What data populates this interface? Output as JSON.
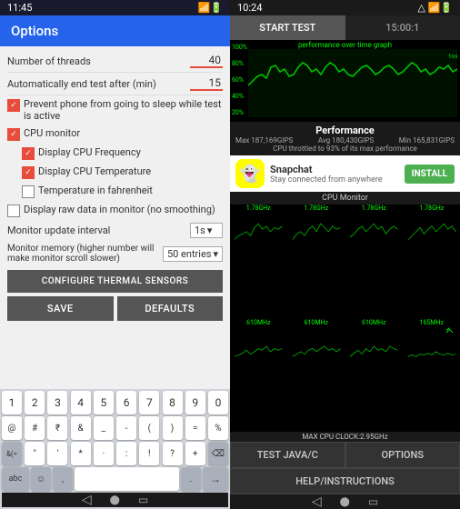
{
  "left": {
    "status_bar": {
      "time": "11:45",
      "icons": "status-icons"
    },
    "title": "Options",
    "fields": {
      "threads_label": "Number of threads",
      "threads_value": "40",
      "auto_end_label": "Automatically end test after (min)",
      "auto_end_value": "15"
    },
    "checkboxes": [
      {
        "id": "prevent_sleep",
        "label": "Prevent phone from going to sleep while test is active",
        "checked": true
      },
      {
        "id": "cpu_monitor",
        "label": "CPU monitor",
        "checked": true
      },
      {
        "id": "cpu_freq",
        "label": "Display CPU Frequency",
        "checked": true,
        "indent": true
      },
      {
        "id": "cpu_temp",
        "label": "Display CPU Temperature",
        "checked": true,
        "indent": true
      },
      {
        "id": "fahrenheit",
        "label": "Temperature in fahrenheit",
        "checked": false,
        "indent": true
      },
      {
        "id": "raw_data",
        "label": "Display raw data in monitor (no smoothing)",
        "checked": false,
        "indent": false
      }
    ],
    "interval_label": "Monitor update interval",
    "interval_value": "1s",
    "memory_label": "Monitor memory (higher number will make monitor scroll slower)",
    "memory_value": "50 entries",
    "configure_btn": "CONFIGURE THERMAL SENSORS",
    "save_btn": "SAVE",
    "defaults_btn": "DEFAULTS"
  },
  "keyboard": {
    "row1": [
      "1",
      "2",
      "3",
      "4",
      "5",
      "6",
      "7",
      "8",
      "9",
      "0"
    ],
    "row2": [
      "@",
      "#",
      "₹",
      "&",
      "_",
      "-",
      "(",
      ")",
      "+",
      "=",
      "%"
    ],
    "row3": [
      "&(=",
      "\"",
      "'",
      "*",
      "·",
      ":",
      "!",
      "?",
      "+",
      "⌫"
    ],
    "bottom": {
      "abc": "abc",
      "comma": ",",
      "space": "",
      "arrow": "→"
    }
  },
  "right": {
    "status_bar": {
      "time": "10:24",
      "icons": "status-icons"
    },
    "start_test_btn": "START TEST",
    "timer": "15:00:1",
    "graph": {
      "title": "performance over time graph",
      "y_labels": [
        "100%",
        "80%",
        "60%",
        "40%",
        "20%"
      ]
    },
    "performance": {
      "title": "Performance",
      "max": "Max 187,169GIPS",
      "avg": "Avg 180,430GIPS",
      "min": "Min 165,831GIPS",
      "throttle": "CPU throttled to 93% of its max performance"
    },
    "ad": {
      "app_name": "Snapchat",
      "tagline": "Stay connected from anywhere",
      "install_label": "INSTALL"
    },
    "cpu_monitor_label": "CPU Monitor",
    "cpu_cells": [
      {
        "freq": "1.78GHz"
      },
      {
        "freq": "1.78GHz"
      },
      {
        "freq": "1.78GHz"
      },
      {
        "freq": "1.78GHz"
      },
      {
        "freq": "610MHz"
      },
      {
        "freq": "610MHz"
      },
      {
        "freq": "610MHz"
      },
      {
        "freq": "165MHz"
      }
    ],
    "max_clock": "MAX CPU CLOCK:2.95GHz",
    "nav": {
      "test_java_c": "TEST JAVA/C",
      "options": "OPTIONS",
      "help": "HELP/INSTRUCTIONS"
    }
  }
}
